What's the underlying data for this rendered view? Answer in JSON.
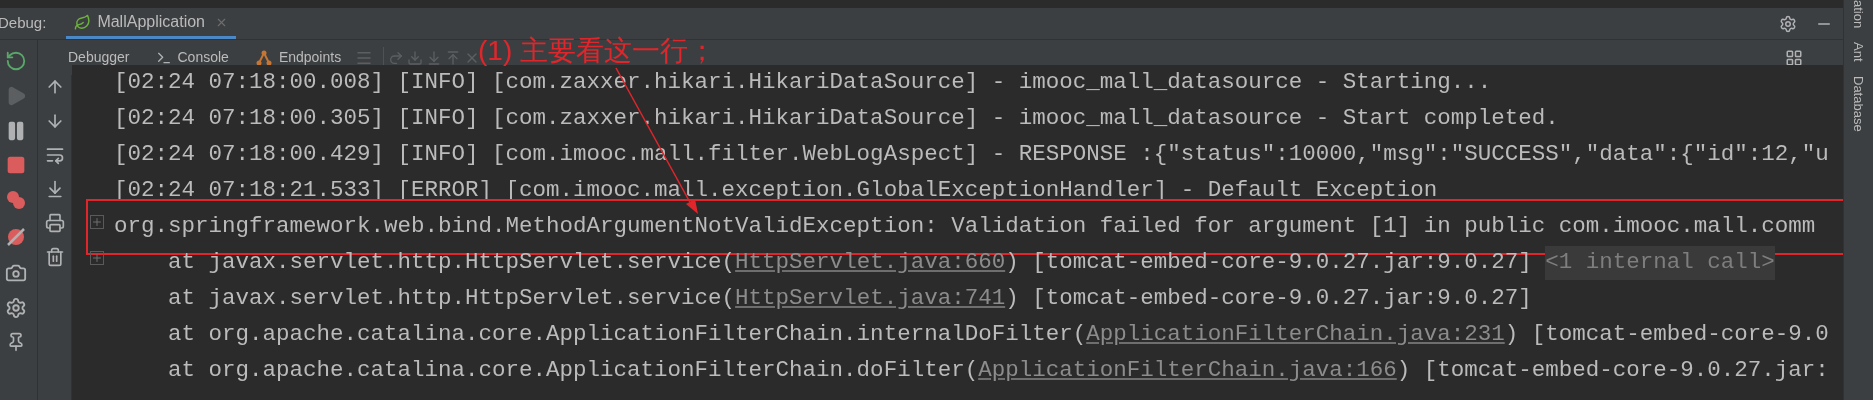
{
  "window": {
    "label": "Debug:",
    "tab": "MallApplication"
  },
  "tabs": [
    {
      "label": "Debugger",
      "kind": "debugger"
    },
    {
      "label": "Console",
      "kind": "console"
    },
    {
      "label": "Endpoints",
      "kind": "endpoints"
    }
  ],
  "step_actions": [
    {
      "kind": "step-over",
      "disabled": true
    },
    {
      "kind": "step-into",
      "disabled": true
    },
    {
      "kind": "force-step-into",
      "disabled": true
    },
    {
      "kind": "step-out",
      "disabled": true
    },
    {
      "kind": "close",
      "disabled": true
    }
  ],
  "debug_actions": [
    {
      "kind": "rerun",
      "disabled": false
    },
    {
      "kind": "resume",
      "disabled": true
    },
    {
      "kind": "pause",
      "disabled": false
    },
    {
      "kind": "stop",
      "disabled": false
    },
    {
      "kind": "breakpoints",
      "disabled": false
    },
    {
      "kind": "mute",
      "disabled": false
    },
    {
      "kind": "camera",
      "disabled": false
    },
    {
      "kind": "settings",
      "disabled": false
    },
    {
      "kind": "pin",
      "disabled": false
    }
  ],
  "side_tools": [
    "ation",
    "Ant",
    "Database"
  ],
  "annotation": {
    "text": "(1) 主要看这一行；"
  },
  "lines": [
    {
      "foldable": false,
      "highlighted": false,
      "segments": [
        {
          "kind": "plain",
          "text": "[02:24 07:18:00.008] [INFO] [com.zaxxer.hikari.HikariDataSource] - imooc_mall_datasource - Starting..."
        }
      ]
    },
    {
      "foldable": false,
      "highlighted": false,
      "segments": [
        {
          "kind": "plain",
          "text": "[02:24 07:18:00.305] [INFO] [com.zaxxer.hikari.HikariDataSource] - imooc_mall_datasource - Start completed."
        }
      ]
    },
    {
      "foldable": false,
      "highlighted": false,
      "segments": [
        {
          "kind": "plain",
          "text": "[02:24 07:18:00.429] [INFO] [com.imooc.mall.filter.WebLogAspect] - RESPONSE :{\"status\":10000,\"msg\":\"SUCCESS\",\"data\":{\"id\":12,\"u"
        }
      ]
    },
    {
      "foldable": false,
      "highlighted": false,
      "segments": [
        {
          "kind": "plain",
          "text": "[02:24 07:18:21.533] [ERROR] [com.imooc.mall.exception.GlobalExceptionHandler] - Default Exception"
        }
      ]
    },
    {
      "foldable": true,
      "highlighted": true,
      "segments": [
        {
          "kind": "plain",
          "text": "org.springframework.web.bind.MethodArgumentNotValidException: Validation failed for argument [1] in public com.imooc.mall.comm"
        }
      ]
    },
    {
      "foldable": true,
      "highlighted": false,
      "segments": [
        {
          "kind": "plain",
          "text": "    at javax.servlet.http.HttpServlet.service("
        },
        {
          "kind": "link",
          "text": "HttpServlet.java:660"
        },
        {
          "kind": "plain",
          "text": ") [tomcat-embed-core-9.0.27.jar:9.0.27] "
        },
        {
          "kind": "folded",
          "text": "<1 internal call>"
        }
      ]
    },
    {
      "foldable": false,
      "highlighted": false,
      "segments": [
        {
          "kind": "plain",
          "text": "    at javax.servlet.http.HttpServlet.service("
        },
        {
          "kind": "link",
          "text": "HttpServlet.java:741"
        },
        {
          "kind": "plain",
          "text": ") [tomcat-embed-core-9.0.27.jar:9.0.27]"
        }
      ]
    },
    {
      "foldable": false,
      "highlighted": false,
      "segments": [
        {
          "kind": "plain",
          "text": "    at org.apache.catalina.core.ApplicationFilterChain.internalDoFilter("
        },
        {
          "kind": "link",
          "text": "ApplicationFilterChain.java:231"
        },
        {
          "kind": "plain",
          "text": ") [tomcat-embed-core-9.0"
        }
      ]
    },
    {
      "foldable": false,
      "highlighted": false,
      "segments": [
        {
          "kind": "plain",
          "text": "    at org.apache.catalina.core.ApplicationFilterChain.doFilter("
        },
        {
          "kind": "link",
          "text": "ApplicationFilterChain.java:166"
        },
        {
          "kind": "plain",
          "text": ") [tomcat-embed-core-9.0.27.jar:"
        }
      ]
    }
  ]
}
